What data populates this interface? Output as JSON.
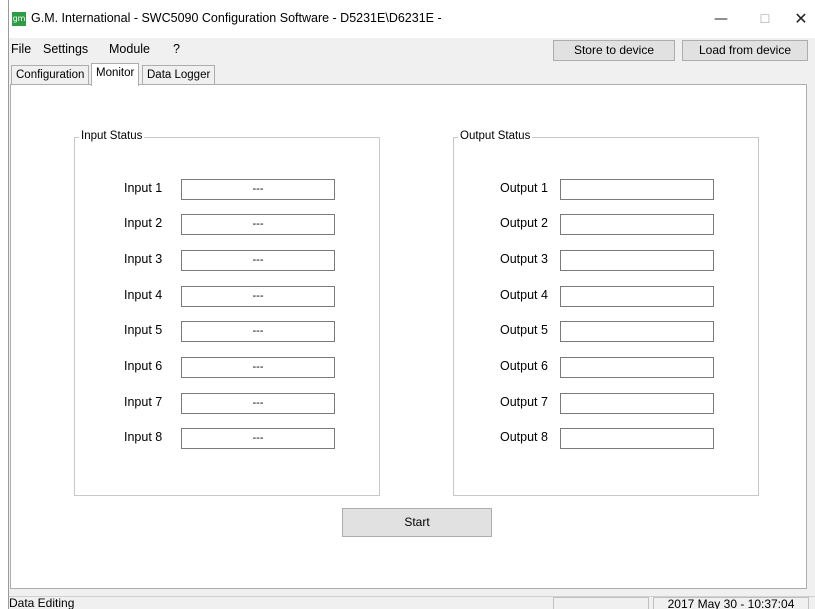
{
  "window": {
    "title": "G.M. International - SWC5090 Configuration Software - D5231E\\D6231E -",
    "icon_text": "gm",
    "controls": {
      "minimize": "—",
      "maximize": "☐",
      "close": "✕"
    }
  },
  "menu": {
    "file": "File",
    "settings": "Settings",
    "module": "Module",
    "help": "?"
  },
  "toolbar": {
    "store_label": "Store to device",
    "load_label": "Load from device"
  },
  "tabs": {
    "configuration": "Configuration",
    "monitor": "Monitor",
    "data_logger": "Data Logger"
  },
  "monitor": {
    "input_group_title": "Input Status",
    "output_group_title": "Output Status",
    "inputs": [
      {
        "label": "Input 1",
        "value": "---"
      },
      {
        "label": "Input 2",
        "value": "---"
      },
      {
        "label": "Input 3",
        "value": "---"
      },
      {
        "label": "Input 4",
        "value": "---"
      },
      {
        "label": "Input 5",
        "value": "---"
      },
      {
        "label": "Input 6",
        "value": "---"
      },
      {
        "label": "Input 7",
        "value": "---"
      },
      {
        "label": "Input 8",
        "value": "---"
      }
    ],
    "outputs": [
      {
        "label": "Output 1",
        "value": ""
      },
      {
        "label": "Output 2",
        "value": ""
      },
      {
        "label": "Output 3",
        "value": ""
      },
      {
        "label": "Output 4",
        "value": ""
      },
      {
        "label": "Output 5",
        "value": ""
      },
      {
        "label": "Output 6",
        "value": ""
      },
      {
        "label": "Output 7",
        "value": ""
      },
      {
        "label": "Output 8",
        "value": ""
      }
    ],
    "start_label": "Start"
  },
  "statusbar": {
    "mode": "Data Editing",
    "middle": "",
    "datetime": "2017 May 30 - 10:37:04"
  }
}
